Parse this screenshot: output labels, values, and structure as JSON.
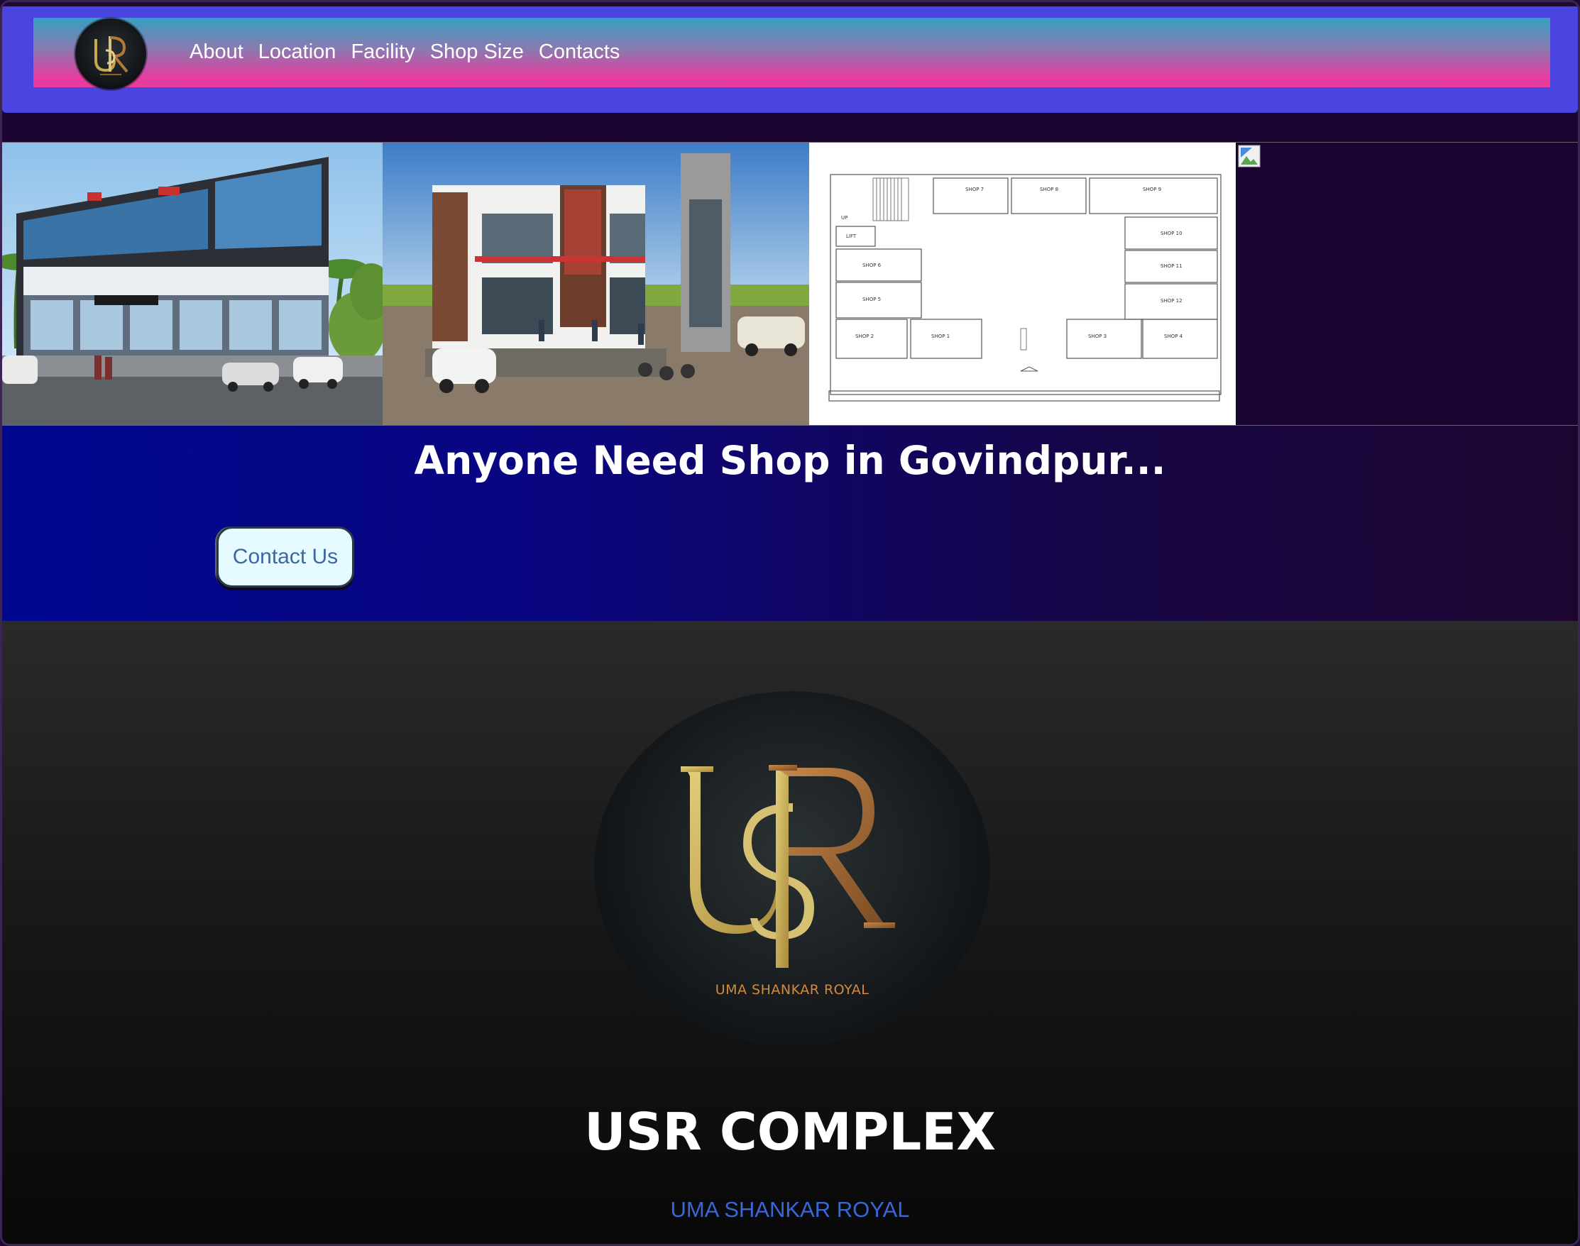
{
  "nav": {
    "logo_text": "UR",
    "items": [
      {
        "label": "About"
      },
      {
        "label": "Location"
      },
      {
        "label": "Facility"
      },
      {
        "label": "Shop Size"
      },
      {
        "label": "Contacts"
      }
    ]
  },
  "gallery": {
    "floorplan_labels": [
      "SHOP 7",
      "SHOP 8",
      "SHOP 9",
      "SHOP 10",
      "SHOP 11",
      "SHOP 12",
      "SHOP 6",
      "SHOP 5",
      "SHOP 2",
      "SHOP 1",
      "SHOP 3",
      "SHOP 4",
      "LIFT",
      "UP"
    ]
  },
  "hero": {
    "title": "Anyone Need Shop in Govindpur...",
    "contact_button": "Contact Us"
  },
  "brand": {
    "logo_caption": "UMA SHANKAR ROYAL",
    "title": "USR COMPLEX",
    "subtitle": "UMA SHANKAR ROYAL"
  },
  "colors": {
    "header_band": "#4a45e0",
    "navbar_top": "#35a0c2",
    "navbar_bottom": "#e83a9c",
    "hero_left": "#00088f",
    "hero_right": "#1c0630",
    "brand_gold": "#c9a84a",
    "brand_bronze": "#b07a3a",
    "subtitle_blue": "#3a67d8",
    "button_bg": "#e6fbff"
  }
}
